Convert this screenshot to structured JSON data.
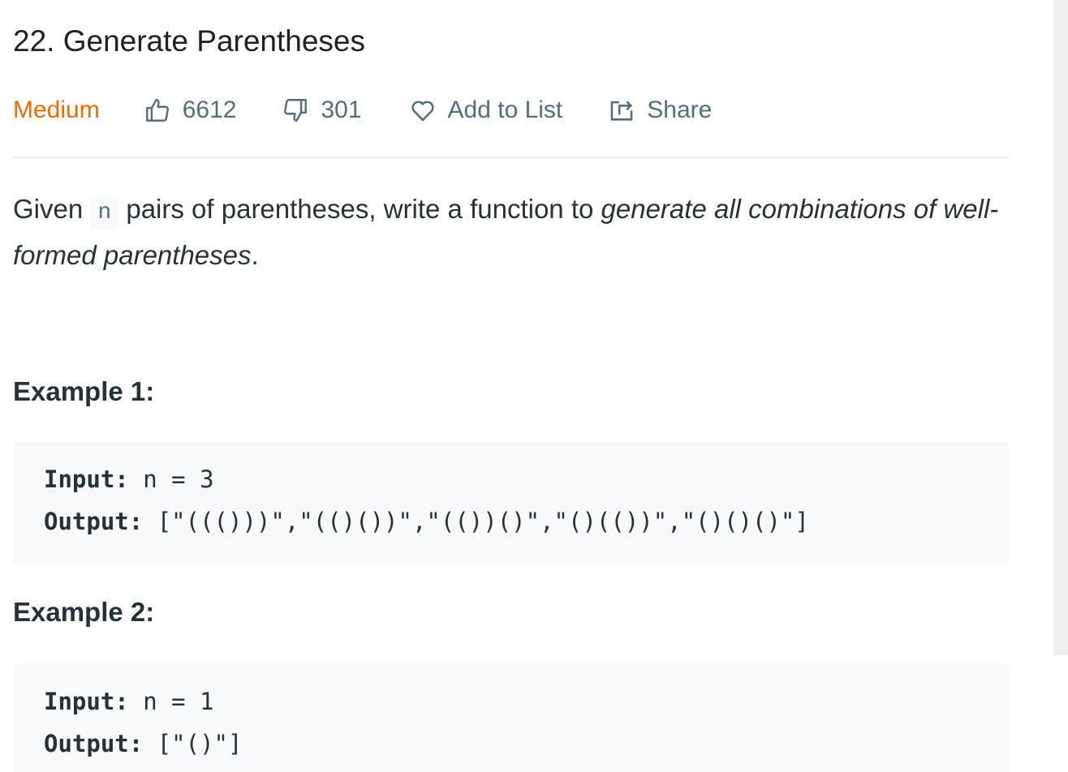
{
  "problem": {
    "title": "22. Generate Parentheses",
    "difficulty": "Medium",
    "likes": "6612",
    "dislikes": "301",
    "add_to_list": "Add to List",
    "share": "Share"
  },
  "description": {
    "prefix": "Given ",
    "code": "n",
    "middle": " pairs of parentheses, write a function to ",
    "emphasis": "generate all combinations of well-formed parentheses",
    "suffix": "."
  },
  "examples": [
    {
      "heading": "Example 1:",
      "input_label": "Input:",
      "input_value": "n = 3",
      "output_label": "Output:",
      "output_value": "[\"((()))\",\"(()())\",\"(())()\",\"()(())\",\"()()()\"]"
    },
    {
      "heading": "Example 2:",
      "input_label": "Input:",
      "input_value": "n = 1",
      "output_label": "Output:",
      "output_value": "[\"()\"]"
    }
  ],
  "icons": {
    "like": "thumbs-up-icon",
    "dislike": "thumbs-down-icon",
    "favorite": "heart-icon",
    "share": "share-icon"
  },
  "colors": {
    "difficulty_medium": "#ef6c00",
    "meta_text": "#546e7a",
    "code_background": "#f7f9fa"
  }
}
